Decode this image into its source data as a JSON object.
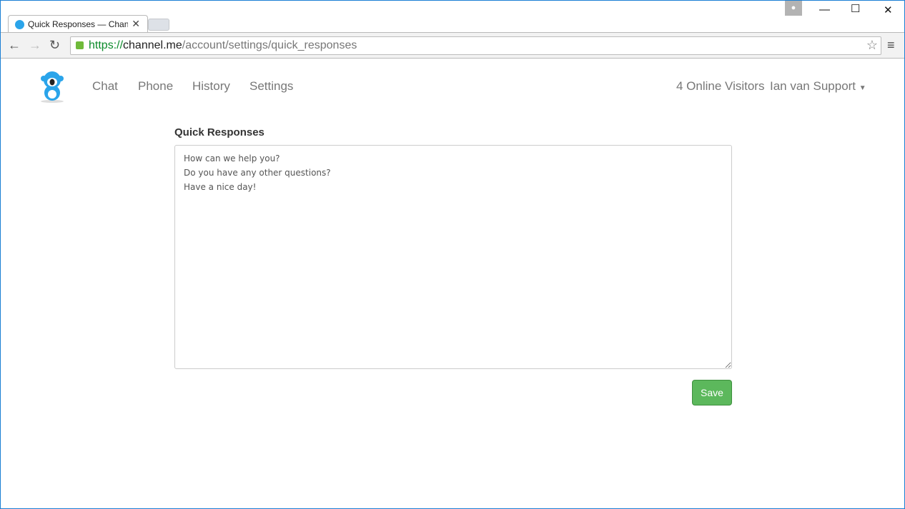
{
  "browser": {
    "tab_title": "Quick Responses — Channel.me",
    "url_scheme": "https://",
    "url_domain": "channel.me",
    "url_path": "/account/settings/quick_responses"
  },
  "nav": {
    "items": [
      {
        "label": "Chat"
      },
      {
        "label": "Phone"
      },
      {
        "label": "History"
      },
      {
        "label": "Settings"
      }
    ],
    "visitors": "4 Online Visitors",
    "user": "Ian van Support"
  },
  "main": {
    "title": "Quick Responses",
    "responses": "How can we help you?\nDo you have any other questions?\nHave a nice day!",
    "save_label": "Save"
  },
  "colors": {
    "accent": "#5cb85c",
    "brand": "#2aa4ea"
  }
}
